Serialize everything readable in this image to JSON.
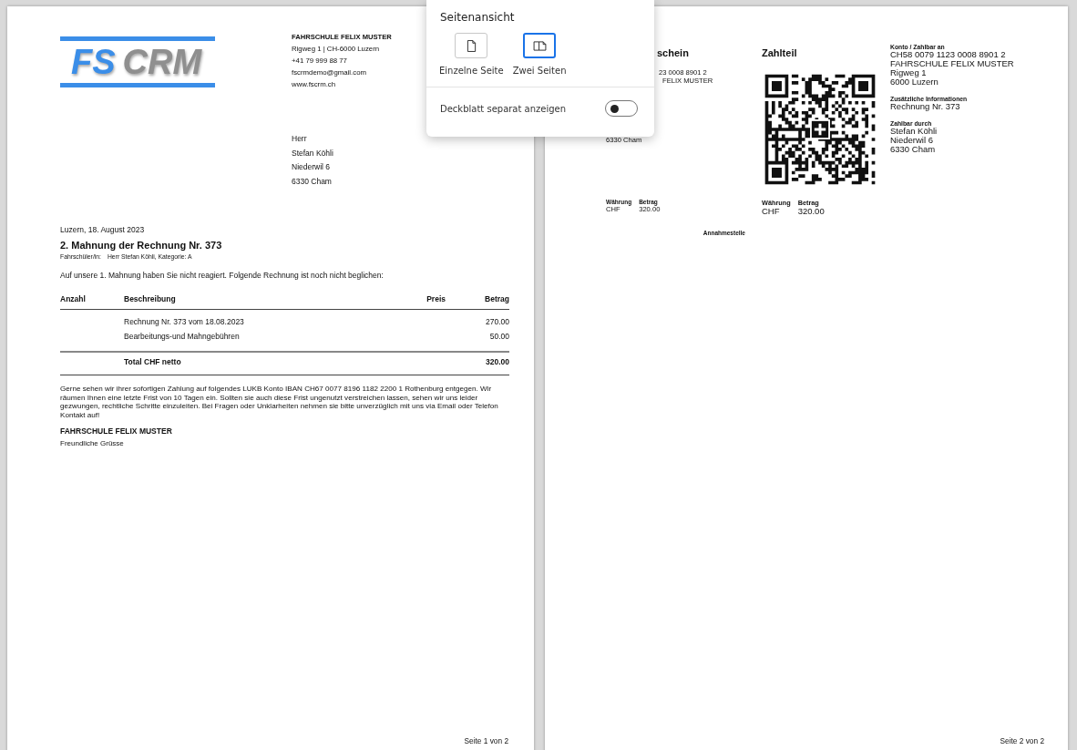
{
  "popup": {
    "title": "Seitenansicht",
    "options": [
      {
        "label": "Einzelne Seite",
        "kind": "single",
        "selected": false
      },
      {
        "label": "Zwei Seiten",
        "kind": "double",
        "selected": true
      }
    ],
    "toggle": {
      "label": "Deckblatt separat anzeigen",
      "on": false
    }
  },
  "page_1": {
    "logo": [
      "FS",
      "CRM"
    ],
    "sender": {
      "name": "FAHRSCHULE FELIX MUSTER",
      "lines": [
        "Rigweg 1 | CH-6000 Luzern",
        "+41 79 999 88 77",
        "fscrmdemo@gmail.com",
        "www.fscrm.ch"
      ]
    },
    "recipient": [
      "Herr",
      "Stefan Köhli",
      "Niederwil 6",
      "6330 Cham"
    ],
    "date": "Luzern, 18. August 2023",
    "title": "2. Mahnung der Rechnung Nr. 373",
    "student": {
      "label": "Fahrschüler/in:",
      "value": "Herr Stefan Köhli, Kategorie: A"
    },
    "intro": "Auf unsere 1. Mahnung haben Sie nicht reagiert. Folgende Rechnung ist noch nicht beglichen:",
    "table": {
      "columns": [
        "Anzahl",
        "Beschreibung",
        "Preis",
        "Betrag"
      ],
      "rows": [
        {
          "description": "Rechnung Nr. 373 vom 18.08.2023",
          "amount": "270.00"
        },
        {
          "description": "Bearbeitungs-und Mahngebühren",
          "amount": "50.00"
        }
      ],
      "total": {
        "label": "Total CHF netto",
        "amount": "320.00"
      }
    },
    "body": "Gerne sehen wir ihrer sofortigen Zahlung auf folgendes LUKB Konto IBAN CH67 0077 8196 1182 2200 1 Rothenburg entgegen. Wir räumen Ihnen eine letzte Frist von 10 Tagen ein. Sollten sie auch diese Frist ungenutzt verstreichen lassen, sehen wir uns leider gezwungen, rechtliche Schritte einzuleiten. Bei Fragen oder Unklarheiten nehmen sie bitte unverzüglich mit uns via Email oder Telefon Kontakt auf!",
    "signature": {
      "name": "FAHRSCHULE FELIX MUSTER",
      "closing": "Freundliche Grüsse"
    },
    "footer": "Seite 1 von 2"
  },
  "page_2": {
    "receipt": {
      "title": "schein",
      "account_lines": [
        "23 0008 8901 2",
        "FELIX MUSTER"
      ],
      "payer_line": "6330 Cham",
      "currency": {
        "label": "Währung",
        "value": "CHF"
      },
      "amount": {
        "label": "Betrag",
        "value": "320.00"
      },
      "acceptance": "Annahmestelle"
    },
    "payment": {
      "title": "Zahlteil",
      "currency": {
        "label": "Währung",
        "value": "CHF"
      },
      "amount": {
        "label": "Betrag",
        "value": "320.00"
      }
    },
    "info": [
      {
        "label": "Konto / Zahlbar an",
        "lines": [
          "CH58 0079 1123 0008 8901 2",
          "FAHRSCHULE FELIX MUSTER",
          "Rigweg 1",
          "6000 Luzern"
        ]
      },
      {
        "label": "Zusätzliche Informationen",
        "lines": [
          "Rechnung Nr. 373"
        ]
      },
      {
        "label": "Zahlbar durch",
        "lines": [
          "Stefan Köhli",
          "Niederwil 6",
          "6330 Cham"
        ]
      }
    ],
    "footer": "Seite 2 von 2"
  }
}
